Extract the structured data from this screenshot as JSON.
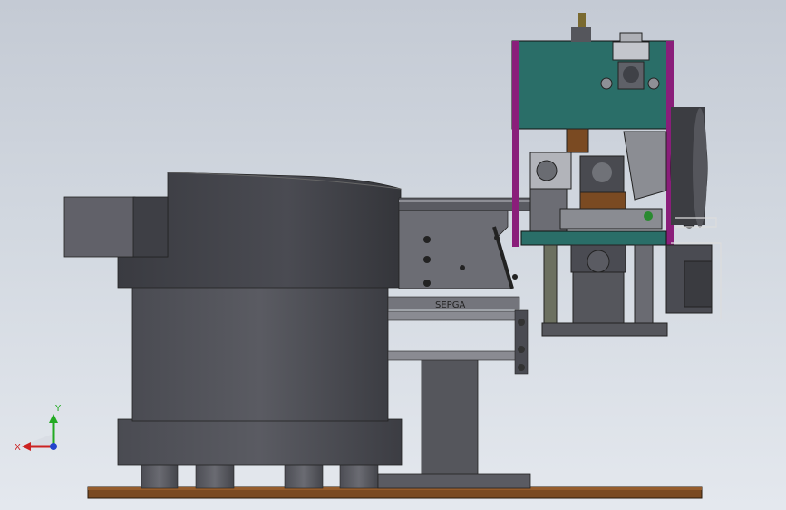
{
  "viewport": {
    "background_top": "#c4cad4",
    "background_bottom": "#e4e8ee"
  },
  "model": {
    "part_label": "SEPGA"
  },
  "triad": {
    "x_label": "X",
    "y_label": "Y",
    "x_color": "#cc2222",
    "y_color": "#22aa22",
    "z_color": "#2244cc"
  }
}
